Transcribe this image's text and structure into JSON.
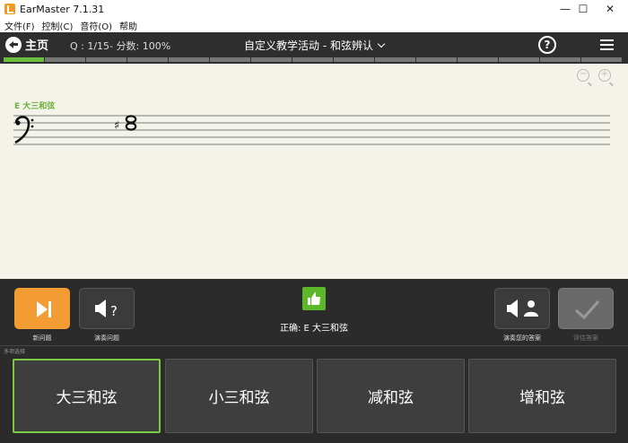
{
  "window": {
    "title": "EarMaster 7.1.31",
    "minimize": "—",
    "maximize": "☐",
    "close": "✕"
  },
  "menu": [
    "文件(F)",
    "控制(C)",
    "音符(O)",
    "帮助"
  ],
  "toolbar": {
    "home_label": "主页",
    "question_info": "Q : 1/15- 分数: 100%",
    "activity_title": "自定义教学活动 - 和弦辨认",
    "help_glyph": "?"
  },
  "progress": {
    "total": 15,
    "completed": 1
  },
  "score": {
    "chord_label": "E 大三和弦",
    "clef": "bass-clef",
    "accidental": "♯"
  },
  "controls": {
    "new_question_label": "新问题",
    "play_question_label": "演奏问题",
    "play_answer_label": "演奏您的答案",
    "evaluate_label": "评估答案",
    "status_text": "正确: E 大三和弦"
  },
  "answers": {
    "section_label": "多项选择",
    "options": [
      "大三和弦",
      "小三和弦",
      "减和弦",
      "增和弦"
    ],
    "selected_index": 0
  },
  "colors": {
    "accent_green": "#6cbf3c",
    "new_question_orange": "#f39c34",
    "toolbar_dark": "#2e2e2e"
  }
}
